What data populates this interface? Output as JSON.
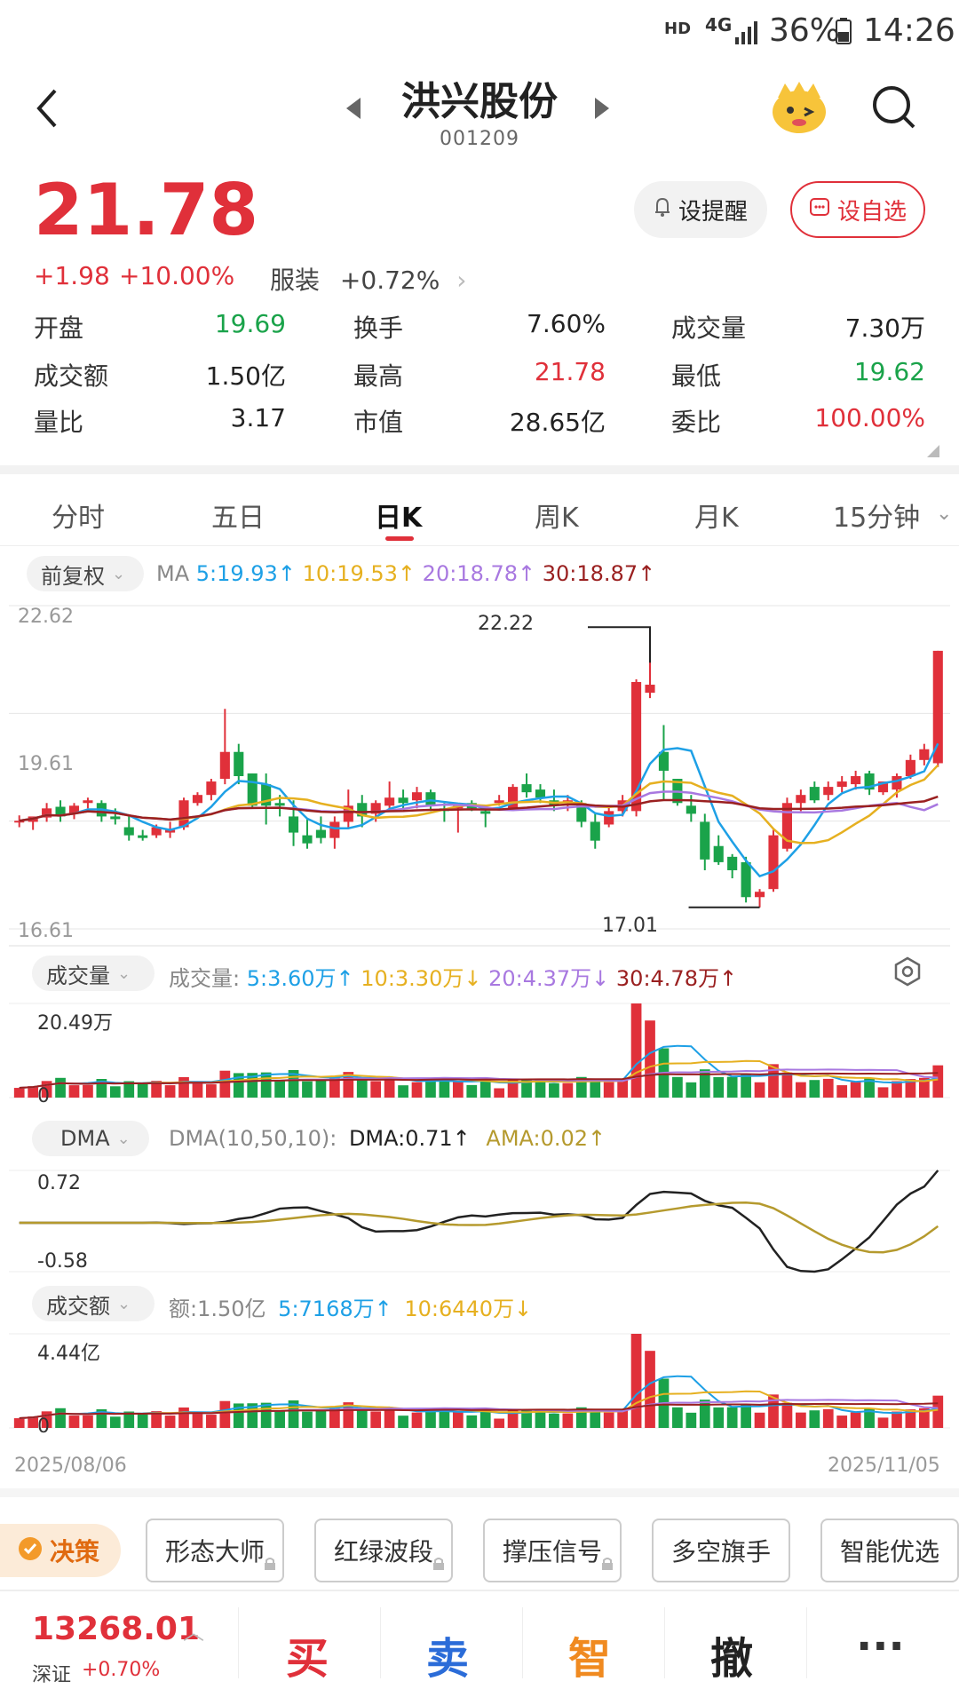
{
  "status": {
    "network": "4G",
    "hd": "HD",
    "battery": "36%",
    "time": "14:26"
  },
  "header": {
    "name": "洪兴股份",
    "code": "001209"
  },
  "quote": {
    "price": "21.78",
    "change": "+1.98",
    "pct": "+10.00%",
    "sector": "服装",
    "sector_pct": "+0.72%",
    "alert_label": "设提醒",
    "watch_label": "设自选"
  },
  "stats": [
    {
      "label": "开盘",
      "value": "19.69",
      "color": "green"
    },
    {
      "label": "换手",
      "value": "7.60%",
      "color": "black"
    },
    {
      "label": "成交量",
      "value": "7.30万",
      "color": "black"
    },
    {
      "label": "成交额",
      "value": "1.50亿",
      "color": "black"
    },
    {
      "label": "最高",
      "value": "21.78",
      "color": "red"
    },
    {
      "label": "最低",
      "value": "19.62",
      "color": "green"
    },
    {
      "label": "量比",
      "value": "3.17",
      "color": "black"
    },
    {
      "label": "市值",
      "value": "28.65亿",
      "color": "black"
    },
    {
      "label": "委比",
      "value": "100.00%",
      "color": "red"
    }
  ],
  "tabs": [
    "分时",
    "五日",
    "日K",
    "周K",
    "月K",
    "15分钟"
  ],
  "active_tab": "日K",
  "kline": {
    "adjust": "前复权",
    "ma_prefix": "MA",
    "ma5": "5:19.93↑",
    "ma10": "10:19.53↑",
    "ma20": "20:18.78↑",
    "ma30": "30:18.87↑",
    "y_top": "22.62",
    "y_mid": "19.61",
    "y_bot": "16.61",
    "high_label": "22.22",
    "low_label": "17.01"
  },
  "volume": {
    "chip": "成交量",
    "prefix": "成交量:",
    "v5": "5:3.60万↑",
    "v10": "10:3.30万↓",
    "v20": "20:4.37万↓",
    "v30": "30:4.78万↑",
    "ymax": "20.49万",
    "yzero": "0"
  },
  "dma": {
    "chip": "DMA",
    "prefix": "DMA(10,50,10):",
    "dma": "DMA:0.71↑",
    "ama": "AMA:0.02↑",
    "ymax": "0.72",
    "ymin": "-0.58"
  },
  "amount": {
    "chip": "成交额",
    "prefix": "额:1.50亿",
    "a5": "5:7168万↑",
    "a10": "10:6440万↓",
    "ymax": "4.44亿",
    "yzero": "0"
  },
  "dates": {
    "start": "2025/08/06",
    "end": "2025/11/05"
  },
  "tools": {
    "decision": "决策",
    "items": [
      "形态大师",
      "红绿波段",
      "撑压信号",
      "多空旗手",
      "智能优选"
    ]
  },
  "bottom": {
    "index_value": "13268.01",
    "index_name": "深证",
    "index_pct": "+0.70%",
    "buy": "买",
    "sell": "卖",
    "smart": "智",
    "cancel": "撤",
    "more": "···"
  },
  "colors": {
    "red": "#e0303a",
    "green": "#1aa34a",
    "ma5": "#1ea0e6",
    "ma10": "#e6b020",
    "ma20": "#a878e0",
    "ma30": "#9a2020"
  },
  "chart_data": {
    "type": "candlestick",
    "x_start": "2025/08/06",
    "x_end": "2025/11/05",
    "ylim": [
      16.61,
      22.62
    ],
    "candles": [
      [
        18.6,
        18.72,
        18.5,
        18.62
      ],
      [
        18.6,
        18.65,
        18.45,
        18.7
      ],
      [
        18.68,
        18.95,
        18.6,
        18.85
      ],
      [
        18.88,
        19.0,
        18.6,
        18.7
      ],
      [
        18.75,
        18.95,
        18.65,
        18.9
      ],
      [
        18.95,
        19.05,
        18.85,
        19.0
      ],
      [
        18.95,
        19.0,
        18.6,
        18.7
      ],
      [
        18.7,
        18.85,
        18.55,
        18.65
      ],
      [
        18.5,
        18.7,
        18.25,
        18.35
      ],
      [
        18.35,
        18.45,
        18.25,
        18.3
      ],
      [
        18.35,
        18.55,
        18.3,
        18.5
      ],
      [
        18.4,
        18.6,
        18.3,
        18.45
      ],
      [
        18.5,
        19.05,
        18.45,
        19.0
      ],
      [
        18.95,
        19.15,
        18.9,
        19.1
      ],
      [
        19.1,
        19.4,
        19.0,
        19.35
      ],
      [
        19.4,
        20.7,
        19.3,
        19.9
      ],
      [
        19.9,
        20.05,
        19.3,
        19.45
      ],
      [
        19.5,
        19.5,
        18.85,
        18.9
      ],
      [
        19.3,
        19.5,
        18.55,
        18.9
      ],
      [
        18.95,
        19.1,
        18.7,
        18.9
      ],
      [
        18.7,
        19.0,
        18.15,
        18.4
      ],
      [
        18.35,
        18.65,
        18.1,
        18.2
      ],
      [
        18.45,
        18.7,
        18.2,
        18.3
      ],
      [
        18.3,
        18.7,
        18.1,
        18.6
      ],
      [
        18.6,
        19.2,
        18.5,
        18.9
      ],
      [
        18.95,
        19.1,
        18.5,
        18.7
      ],
      [
        18.75,
        19.0,
        18.6,
        18.95
      ],
      [
        18.9,
        19.35,
        18.85,
        19.05
      ],
      [
        19.05,
        19.2,
        18.85,
        18.95
      ],
      [
        19.0,
        19.25,
        18.85,
        19.15
      ],
      [
        19.15,
        19.2,
        18.8,
        18.9
      ],
      [
        18.85,
        18.95,
        18.6,
        18.8
      ],
      [
        18.85,
        18.9,
        18.4,
        18.9
      ],
      [
        18.95,
        19.0,
        18.8,
        18.85
      ],
      [
        18.8,
        18.9,
        18.5,
        18.75
      ],
      [
        18.95,
        19.1,
        18.9,
        19.0
      ],
      [
        18.85,
        19.3,
        18.8,
        19.25
      ],
      [
        19.3,
        19.5,
        19.05,
        19.15
      ],
      [
        19.2,
        19.3,
        18.95,
        19.05
      ],
      [
        19.0,
        19.2,
        18.8,
        18.9
      ],
      [
        18.95,
        19.1,
        18.8,
        19.0
      ],
      [
        18.95,
        19.0,
        18.5,
        18.6
      ],
      [
        18.6,
        18.75,
        18.1,
        18.25
      ],
      [
        18.55,
        18.9,
        18.5,
        18.8
      ],
      [
        18.8,
        19.1,
        18.7,
        19.0
      ],
      [
        18.8,
        21.25,
        18.7,
        21.2
      ],
      [
        21.0,
        22.22,
        20.9,
        21.15
      ],
      [
        19.9,
        20.4,
        19.0,
        19.55
      ],
      [
        19.4,
        19.4,
        18.9,
        18.95
      ],
      [
        18.9,
        19.1,
        18.6,
        18.75
      ],
      [
        18.6,
        18.75,
        17.7,
        17.9
      ],
      [
        18.15,
        18.35,
        17.8,
        17.85
      ],
      [
        17.95,
        18.0,
        17.55,
        17.7
      ],
      [
        17.85,
        17.95,
        17.1,
        17.2
      ],
      [
        17.2,
        17.35,
        17.01,
        17.3
      ],
      [
        17.35,
        18.45,
        17.3,
        18.35
      ],
      [
        18.1,
        19.05,
        18.05,
        18.95
      ],
      [
        18.95,
        19.2,
        18.8,
        19.1
      ],
      [
        19.25,
        19.35,
        18.95,
        19.0
      ],
      [
        19.1,
        19.35,
        19.0,
        19.25
      ],
      [
        19.25,
        19.45,
        19.15,
        19.35
      ],
      [
        19.3,
        19.55,
        19.2,
        19.45
      ],
      [
        19.5,
        19.55,
        19.1,
        19.2
      ],
      [
        19.15,
        19.35,
        19.1,
        19.35
      ],
      [
        19.2,
        19.5,
        19.05,
        19.45
      ],
      [
        19.45,
        19.85,
        19.4,
        19.75
      ],
      [
        19.75,
        20.05,
        19.65,
        19.95
      ],
      [
        19.69,
        21.78,
        19.62,
        21.78
      ]
    ],
    "volume_ymax": "20.49万",
    "amount_ymax": "4.44亿",
    "dma_range": [
      -0.58,
      0.72
    ]
  }
}
